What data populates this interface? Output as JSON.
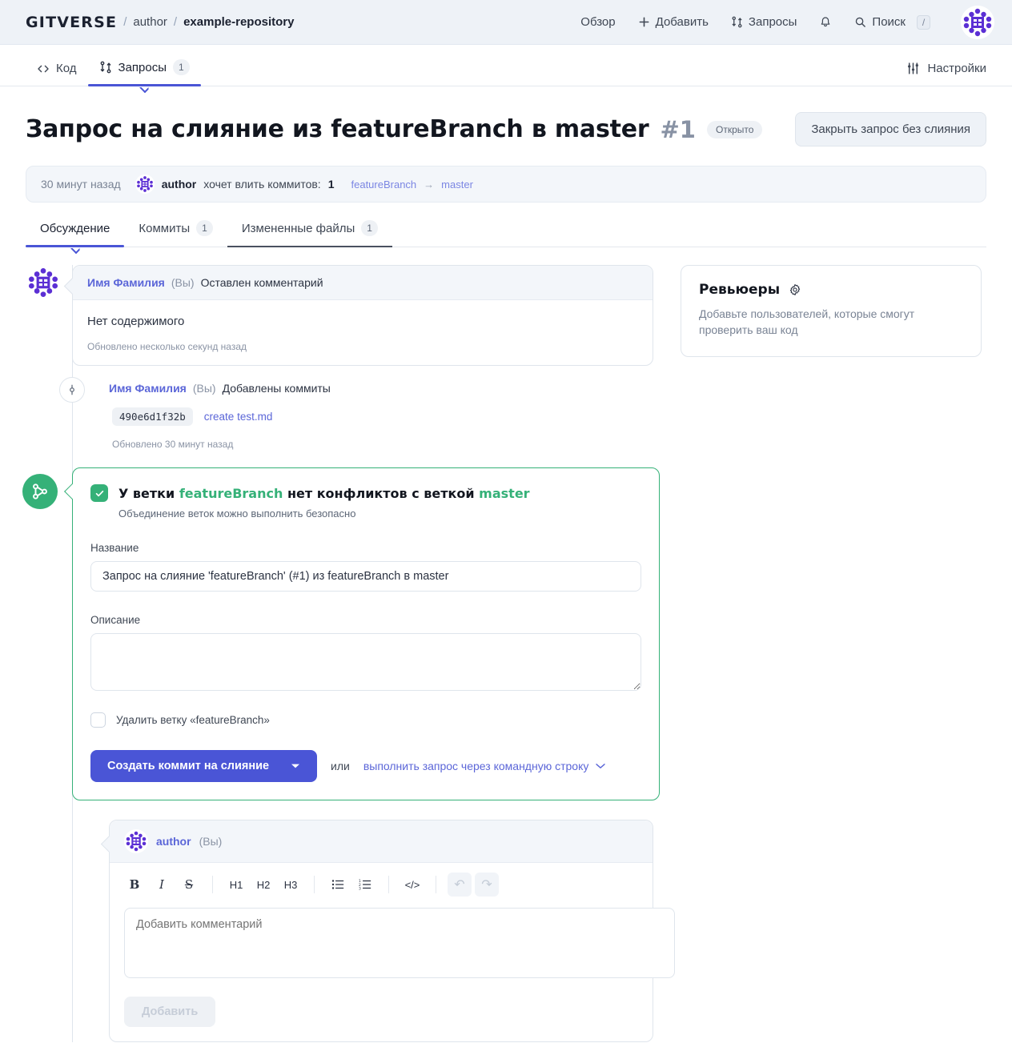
{
  "topbar": {
    "brand": "GITVERSE",
    "sep": "/",
    "owner": "author",
    "repo": "example-repository",
    "nav": [
      {
        "label": "Обзор",
        "icon": ""
      },
      {
        "label": "Добавить",
        "icon": "plus-icon"
      },
      {
        "label": "Запросы",
        "icon": "pull-request-icon"
      }
    ],
    "bell_icon": "bell-icon",
    "search_label": "Поиск",
    "search_kbd": "/",
    "avatar": "user-avatar"
  },
  "reponav": {
    "tabs": [
      {
        "label": "Код",
        "icon": "code-icon",
        "count": "",
        "active": false
      },
      {
        "label": "Запросы",
        "icon": "pull-request-icon",
        "count": "1",
        "active": true
      }
    ],
    "settings_label": "Настройки",
    "settings_icon": "sliders-icon"
  },
  "header": {
    "title": "Запрос на слияние из featureBranch в master",
    "number": "#1",
    "state": "Открыто",
    "close_button": "Закрыть запрос без слияния"
  },
  "meta": {
    "time": "30 минут назад",
    "avatar": "author-avatar",
    "author": "author",
    "text": "хочет влить коммитов:",
    "count": "1",
    "source_branch": "featureBranch",
    "arrow": "→",
    "target_branch": "master"
  },
  "subtabs": [
    {
      "label": "Обсуждение",
      "count": "",
      "active": true,
      "hovered": false
    },
    {
      "label": "Коммиты",
      "count": "1",
      "active": false,
      "hovered": false
    },
    {
      "label": "Измененные файлы",
      "count": "1",
      "active": false,
      "hovered": true
    }
  ],
  "comment": {
    "avatar": "user-avatar",
    "name": "Имя Фамилия",
    "you": "(Вы)",
    "action": "Оставлен комментарий",
    "body": "Нет содержимого",
    "updated": "Обновлено несколько секунд назад"
  },
  "commit_event": {
    "icon": "commit-icon",
    "name": "Имя Фамилия",
    "you": "(Вы)",
    "action": "Добавлены коммиты",
    "sha": "490e6d1f32b",
    "message": "create test.md",
    "updated": "Обновлено 30 минут назад"
  },
  "merge": {
    "icon": "merge-icon",
    "check_icon": "check-icon",
    "title_prefix": "У ветки",
    "source_branch": "featureBranch",
    "title_middle": "нет конфликтов с веткой",
    "target_branch": "master",
    "subtitle": "Объединение веток можно выполнить безопасно",
    "name_label": "Название",
    "name_value": "Запрос на слияние 'featureBranch' (#1) из featureBranch в master",
    "desc_label": "Описание",
    "desc_value": "",
    "desc_placeholder": "",
    "delete_branch_label": "Удалить ветку «featureBranch»",
    "delete_branch_checked": false,
    "merge_button": "Создать коммит на слияние",
    "dropdown_icon": "chevron-down-icon",
    "or": "или",
    "cli_link": "выполнить запрос через командную строку",
    "cli_chevron": "chevron-down-icon"
  },
  "composer": {
    "avatar": "author-avatar",
    "name": "author",
    "you": "(Вы)",
    "toolbar": [
      {
        "name": "bold-icon",
        "glyph": "B",
        "style": "bold",
        "disabled": false
      },
      {
        "name": "italic-icon",
        "glyph": "I",
        "style": "italic",
        "disabled": false
      },
      {
        "name": "strikethrough-icon",
        "glyph": "S",
        "style": "strike",
        "disabled": false
      },
      {
        "name": "heading-1-icon",
        "glyph": "H1",
        "style": "sans",
        "disabled": false
      },
      {
        "name": "heading-2-icon",
        "glyph": "H2",
        "style": "sans",
        "disabled": false
      },
      {
        "name": "heading-3-icon",
        "glyph": "H3",
        "style": "sans",
        "disabled": false
      },
      {
        "name": "bullet-list-icon",
        "glyph": "☰",
        "style": "sans",
        "disabled": false
      },
      {
        "name": "numbered-list-icon",
        "glyph": "☷",
        "style": "sans",
        "disabled": false
      },
      {
        "name": "code-icon",
        "glyph": "</>",
        "style": "sans",
        "disabled": false
      },
      {
        "name": "undo-icon",
        "glyph": "↶",
        "style": "sans",
        "disabled": true
      },
      {
        "name": "redo-icon",
        "glyph": "↷",
        "style": "sans",
        "disabled": true
      }
    ],
    "placeholder": "Добавить комментарий",
    "value": "",
    "submit": "Добавить"
  },
  "reviewers": {
    "title": "Ревьюеры",
    "gear_icon": "gear-icon",
    "description": "Добавьте пользователей, которые смогут проверить ваш код"
  },
  "colors": {
    "accent": "#4a55d6",
    "link": "#5b66d8",
    "success": "#35b178",
    "muted": "#798394",
    "bg": "#eef2f7"
  }
}
